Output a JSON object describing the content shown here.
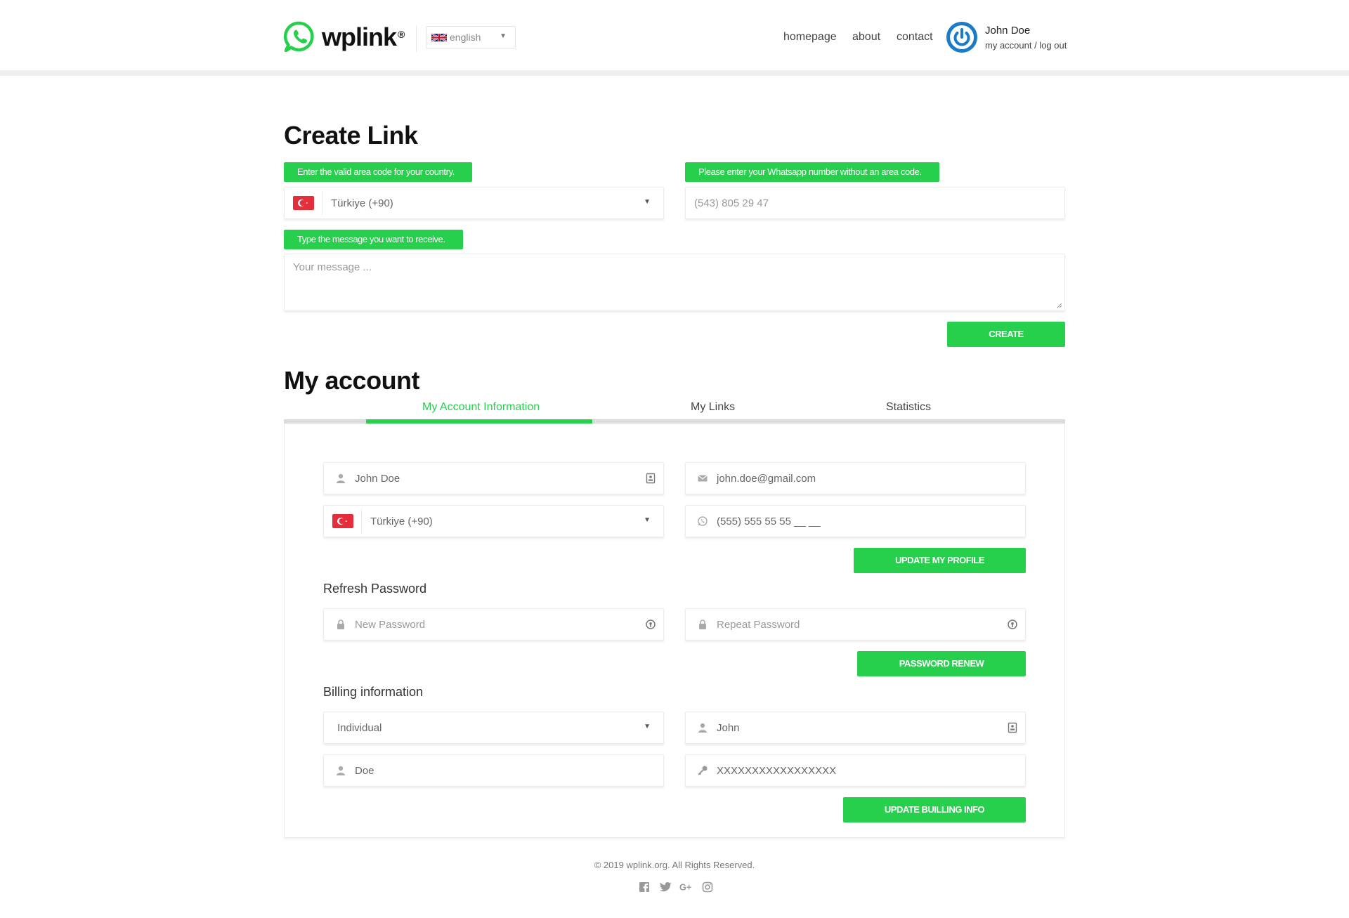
{
  "header": {
    "brand": "wplink",
    "brand_mark": "®",
    "language": "english",
    "nav": [
      "homepage",
      "about",
      "contact"
    ],
    "user_name": "John Doe",
    "user_links": "my account / log out"
  },
  "create_link": {
    "title": "Create Link",
    "hint_area_code": "Enter the valid area code for your country.",
    "hint_number": "Please enter your Whatsapp number without an area code.",
    "country_value": "Türkiye (+90)",
    "number_placeholder": "(543) 805 29 47",
    "hint_message": "Type the message you want to receive.",
    "message_placeholder": "Your message ...",
    "create_button": "CREATE"
  },
  "account": {
    "title": "My account",
    "tabs": [
      "My Account Information",
      "My Links",
      "Statistics"
    ],
    "active_tab": "My Account Information",
    "name_value": "John Doe",
    "email_value": "john.doe@gmail.com",
    "country_value": "Türkiye (+90)",
    "phone_value": "(555) 555 55 55 __ __",
    "update_profile_button": "UPDATE MY PROFILE",
    "password_heading": "Refresh Password",
    "new_password_placeholder": "New Password",
    "repeat_password_placeholder": "Repeat Password",
    "password_button": "PASSWORD RENEW",
    "billing_heading": "Billing information",
    "billing_type": "Individual",
    "billing_first_name": "John",
    "billing_last_name": "Doe",
    "billing_tax_id": "XXXXXXXXXXXXXXXXX",
    "billing_button": "UPDATE BUILLING INFO"
  },
  "footer": {
    "copyright": "© 2019 wplink.org. All Rights Reserved.",
    "social_icons": [
      "facebook-icon",
      "twitter-icon",
      "google-plus-icon",
      "instagram-icon"
    ]
  },
  "colors": {
    "accent": "#26d04c",
    "user_icon": "#1a7bc8"
  }
}
